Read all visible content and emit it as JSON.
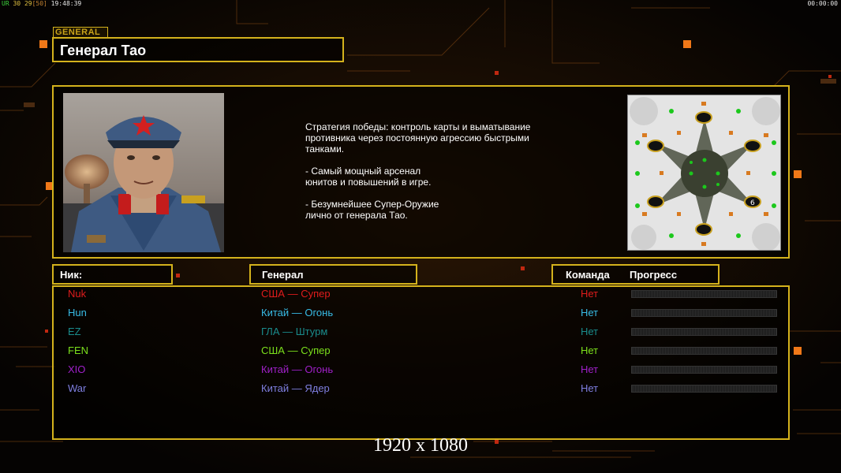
{
  "hud": {
    "left_a": "UR",
    "left_b": "30",
    "left_c": "29",
    "left_d": "[50]",
    "left_time": "19:48:39",
    "right_time": "00:00:00"
  },
  "general": {
    "tag": "GENERAL",
    "name": "Генерал Тао",
    "description": "Стратегия победы: контроль карты и выматывание\n противника через постоянную агрессию быстрыми\n танками.\n\n- Самый мощный арсенал\nюнитов и повышений в игре.\n\n- Безумнейшее Супер-Оружие\nлично от генерала Тао."
  },
  "minimap": {
    "start_slot_label": "6"
  },
  "headers": {
    "nick": "Ник:",
    "general": "Генерал",
    "team": "Команда",
    "progress": "Прогресс"
  },
  "players": [
    {
      "nick": "Nuk",
      "general": "США — Супер",
      "team": "Нет",
      "color": "#e01c1c",
      "progress": 0
    },
    {
      "nick": "Hun",
      "general": "Китай — Огонь",
      "team": "Нет",
      "color": "#38bce6",
      "progress": 0
    },
    {
      "nick": "EZ",
      "general": "ГЛА — Штурм",
      "team": "Нет",
      "color": "#1a8c8c",
      "progress": 0
    },
    {
      "nick": "FEN",
      "general": "США — Супер",
      "team": "Нет",
      "color": "#7ce01c",
      "progress": 0
    },
    {
      "nick": "XIO",
      "general": "Китай — Огонь",
      "team": "Нет",
      "color": "#a020c8",
      "progress": 0
    },
    {
      "nick": "War",
      "general": "Китай — Ядер",
      "team": "Нет",
      "color": "#7f7fe0",
      "progress": 0
    }
  ],
  "resolution": "1920 x 1080",
  "colors": {
    "frame": "#d4b21c",
    "background": "#080502",
    "accent_orange": "#f07818"
  }
}
